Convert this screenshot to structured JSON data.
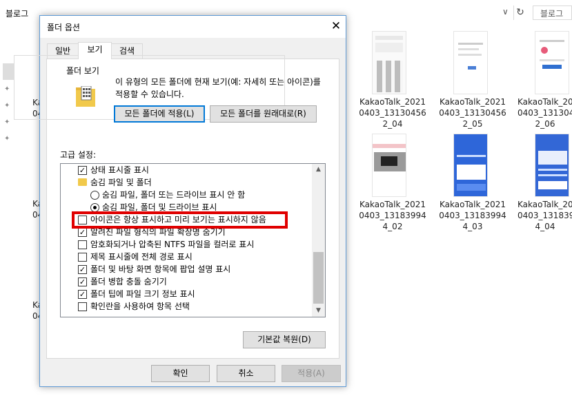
{
  "explorer": {
    "address_path": "블로그",
    "search_placeholder": "블로그 ",
    "bg_fragments": [
      "Ka\n04",
      "Ka\n04",
      "Ka\n04"
    ],
    "thumbnails": [
      {
        "line1": "KakaoTalk_2021",
        "line2": "0403_13130456",
        "line3": "2_04"
      },
      {
        "line1": "KakaoTalk_2021",
        "line2": "0403_13130456",
        "line3": "2_05"
      },
      {
        "line1": "KakaoTalk_20",
        "line2": "0403_131304",
        "line3": "2_06"
      },
      {
        "line1": "KakaoTalk_2021",
        "line2": "0403_13183994",
        "line3": "4_02"
      },
      {
        "line1": "KakaoTalk_2021",
        "line2": "0403_13183994",
        "line3": "4_03"
      },
      {
        "line1": "KakaoTalk_20",
        "line2": "0403_131839",
        "line3": "4_04"
      }
    ]
  },
  "dialog": {
    "title": "폴더 옵션",
    "tabs": [
      {
        "label": "일반",
        "active": false
      },
      {
        "label": "보기",
        "active": true
      },
      {
        "label": "검색",
        "active": false
      }
    ],
    "folder_view": {
      "group_title": "폴더 보기",
      "description": "이 유형의 모든 폴더에 현재 보기(예: 자세히 또는 아이콘)를 적용할 수 있습니다.",
      "apply_all_button": "모든 폴더에 적용(L)",
      "reset_all_button": "모든 폴더를 원래대로(R)"
    },
    "advanced": {
      "label": "고급 설정:",
      "rows": [
        {
          "type": "checkbox",
          "checked": true,
          "indent": 0,
          "label": "상태 표시줄 표시"
        },
        {
          "type": "folder",
          "indent": 0,
          "label": "숨김 파일 및 폴더"
        },
        {
          "type": "radio",
          "checked": false,
          "indent": 1,
          "label": "숨김 파일, 폴더 또는 드라이브 표시 안 함"
        },
        {
          "type": "radio",
          "checked": true,
          "indent": 1,
          "label": "숨김 파일, 폴더 및 드라이브 표시"
        },
        {
          "type": "checkbox",
          "checked": false,
          "indent": 0,
          "label": "아이콘은 항상 표시하고 미리 보기는 표시하지 않음"
        },
        {
          "type": "checkbox",
          "checked": true,
          "indent": 0,
          "label": "알려진 파일 형식의 파일 확장명 숨기기"
        },
        {
          "type": "checkbox",
          "checked": false,
          "indent": 0,
          "label": "암호화되거나 압축된 NTFS 파일을 컬러로 표시"
        },
        {
          "type": "checkbox",
          "checked": false,
          "indent": 0,
          "label": "제목 표시줄에 전체 경로 표시"
        },
        {
          "type": "checkbox",
          "checked": true,
          "indent": 0,
          "label": "폴더 및 바탕 화면 항목에 팝업 설명 표시"
        },
        {
          "type": "checkbox",
          "checked": true,
          "indent": 0,
          "label": "폴더 병합 충돌 숨기기"
        },
        {
          "type": "checkbox",
          "checked": true,
          "indent": 0,
          "label": "폴더 팁에 파일 크기 정보 표시"
        },
        {
          "type": "checkbox",
          "checked": false,
          "indent": 0,
          "label": "확인란을 사용하여 항목 선택"
        }
      ],
      "restore_defaults_button": "기본값 복원(D)"
    },
    "footer": {
      "ok_button": "확인",
      "cancel_button": "취소",
      "apply_button": "적용(A)"
    }
  }
}
